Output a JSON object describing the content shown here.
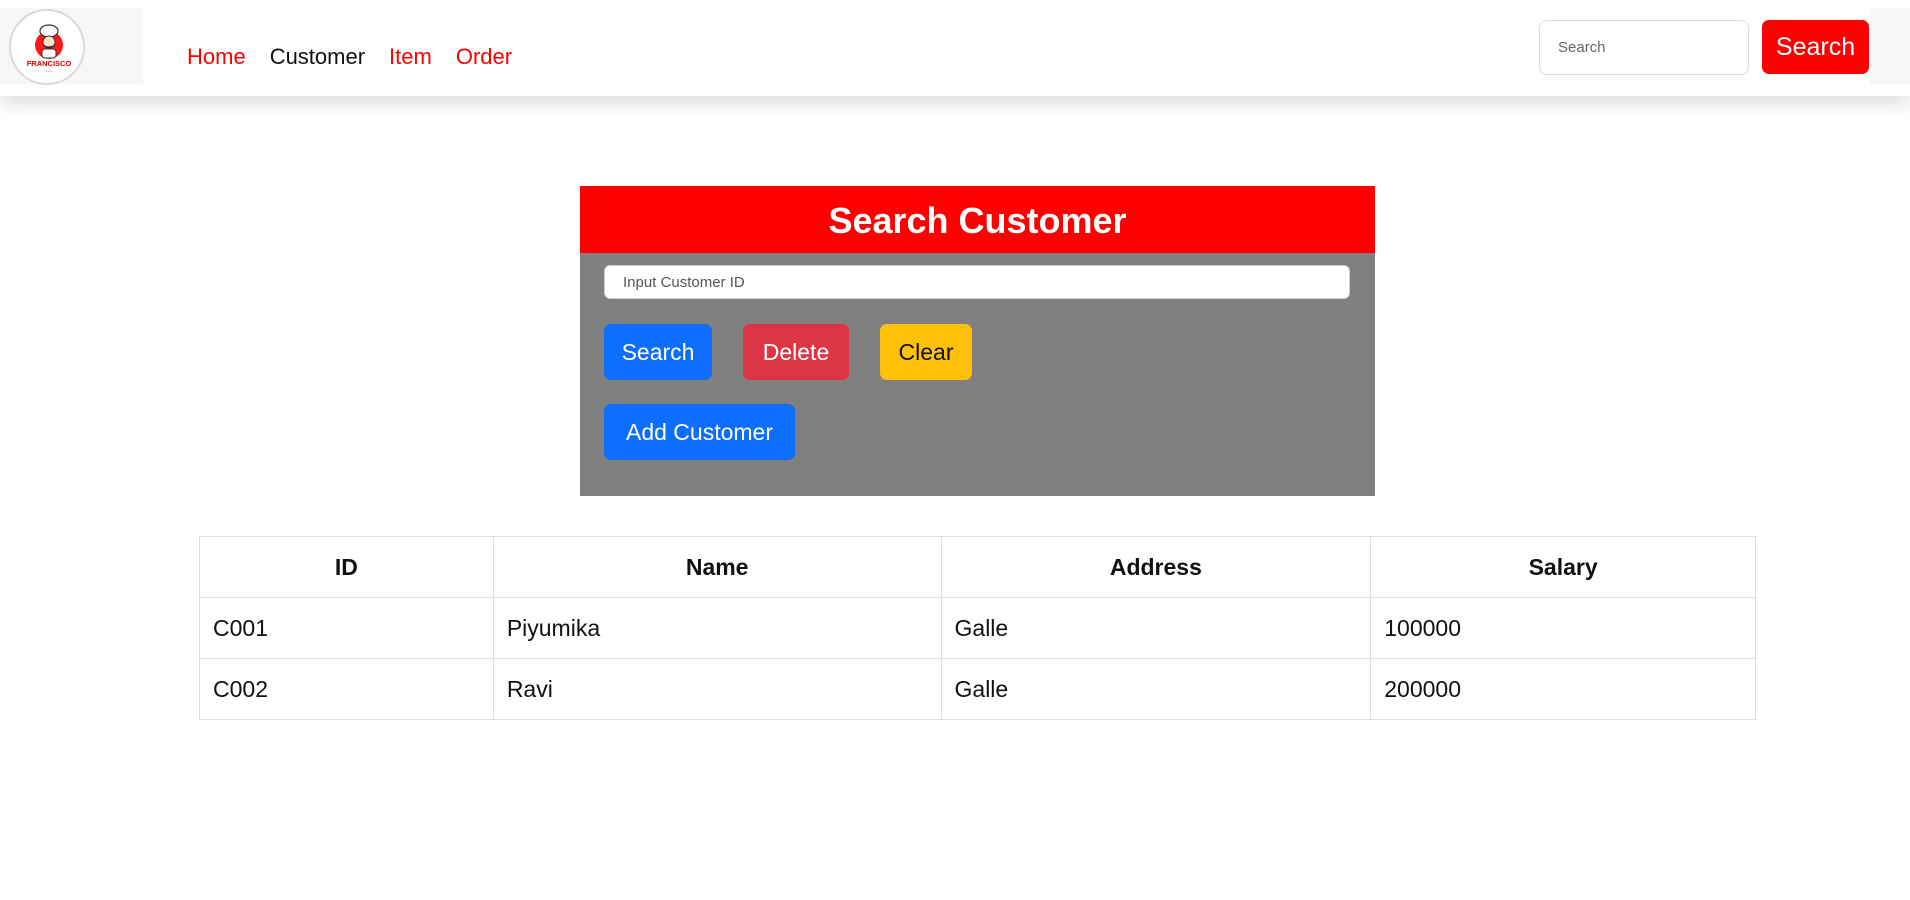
{
  "navbar": {
    "logo_alt": "FRANCISCO",
    "links": [
      {
        "label": "Home"
      },
      {
        "label": "Customer",
        "active": true
      },
      {
        "label": "Item"
      },
      {
        "label": "Order"
      }
    ],
    "search_placeholder": "Search",
    "search_button_label": "Search"
  },
  "panel": {
    "title": "Search Customer",
    "input_placeholder": "Input Customer ID",
    "buttons": {
      "search": "Search",
      "delete": "Delete",
      "clear": "Clear",
      "add": "Add Customer"
    }
  },
  "table": {
    "columns": [
      "ID",
      "Name",
      "Address",
      "Salary"
    ],
    "rows": [
      [
        "C001",
        "Piyumika",
        "Galle",
        "100000"
      ],
      [
        "C002",
        "Ravi",
        "Galle",
        "200000"
      ]
    ]
  },
  "colors": {
    "brand_red": "#ff0000",
    "primary_blue": "#0d6efd",
    "danger_red": "#dc3545",
    "warning_yellow": "#ffc107",
    "panel_gray": "#808080"
  }
}
